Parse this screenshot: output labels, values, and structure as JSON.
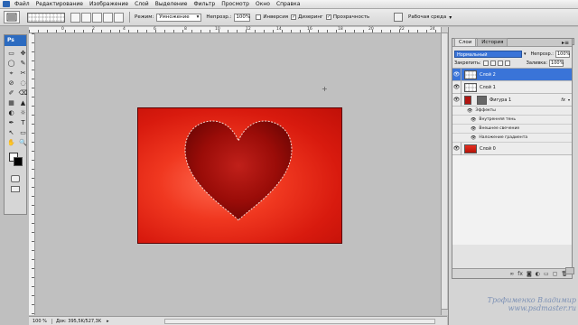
{
  "menubar": {
    "items": [
      "Файл",
      "Редактирование",
      "Изображение",
      "Слой",
      "Выделение",
      "Фильтр",
      "Просмотр",
      "Окно",
      "Справка"
    ]
  },
  "options": {
    "mode_label": "Режим:",
    "mode_value": "Умножение",
    "opacity_label": "Непрозр.:",
    "opacity_value": "100%",
    "invert_label": "Инверсия",
    "invert_checked": false,
    "dither_label": "Дизеринг",
    "dither_checked": true,
    "transparency_label": "Прозрачность",
    "transparency_checked": true,
    "workspace_label": "Рабочая среда"
  },
  "toolbox": {
    "logo": "Ps",
    "tools": [
      "▭",
      "✥",
      "◯",
      "✎",
      "⌖",
      "✂",
      "⊘",
      "◌",
      "✐",
      "⌫",
      "▦",
      "▲",
      "◐",
      "☼",
      "✒",
      "T",
      "↖",
      "▭",
      "✋",
      "🔍"
    ]
  },
  "ruler": {
    "top_labels": [
      "0",
      "2",
      "4",
      "6",
      "8",
      "10",
      "12",
      "14",
      "16",
      "18",
      "20",
      "22",
      "24"
    ]
  },
  "canvas": {
    "background_color": "#c0c0c0",
    "document_color": "#e42814",
    "heart_color": "#a0100a"
  },
  "statusbar": {
    "zoom": "100 %",
    "doc_info": "Док: 395,5K/527,3K"
  },
  "layers_panel": {
    "tabs": [
      "Слои",
      "История"
    ],
    "blend_mode": "Нормальный",
    "opacity_label": "Непрозр.:",
    "opacity_value": "100%",
    "lock_label": "Закрепить:",
    "fill_label": "Заливка:",
    "fill_value": "100%",
    "layers": [
      {
        "name": "Слой 2",
        "selected": true
      },
      {
        "name": "Слой 1",
        "selected": false
      },
      {
        "name": "Фигура 1",
        "selected": false,
        "fx": "fx"
      },
      {
        "name": "Слой 0",
        "selected": false
      }
    ],
    "effects_label": "Эффекты",
    "effects": [
      "Внутренняя тень",
      "Внешнее свечение",
      "Наложение градиента"
    ],
    "footer_icons": [
      "link-icon",
      "fx-icon",
      "mask-icon",
      "adjustment-icon",
      "folder-icon",
      "new-layer-icon",
      "trash-icon"
    ]
  },
  "watermark": {
    "line1": "Трофименко Владимир",
    "line2": "www.psdmaster.ru"
  }
}
